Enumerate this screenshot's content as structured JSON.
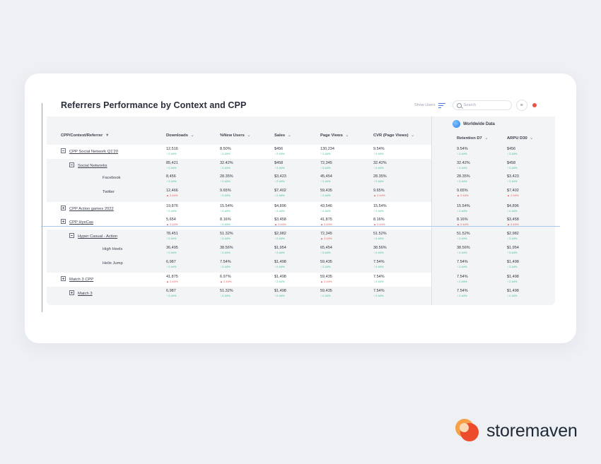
{
  "title": "Referrers Performance by Context and CPP",
  "toolbar": {
    "show_label": "Show Users",
    "search_placeholder": "Search",
    "filter_icon": "filter-lines-icon",
    "flag_icon": "flag-icon"
  },
  "worldwide_label": "Worldwide Data",
  "columns": [
    "CPP/Context/Referrer",
    "Downloads",
    "%New Users",
    "Sales",
    "Page Views",
    "CVR (Page Views)",
    "Retention D7",
    "ARPU D30"
  ],
  "rows": [
    {
      "name": "CPP Social Network Q1'20",
      "level": 0,
      "toggle": "minus",
      "link": true,
      "cells": [
        [
          "12,516",
          "2.44%",
          "up"
        ],
        [
          "8.50%",
          "2.44%",
          "up"
        ],
        [
          "$456",
          "2.44%",
          "up"
        ],
        [
          "130,234",
          "2.44%",
          "up"
        ],
        [
          "9.54%",
          "2.44%",
          "up"
        ],
        [
          "9.54%",
          "2.44%",
          "up"
        ],
        [
          "$456",
          "2.44%",
          "up"
        ]
      ]
    },
    {
      "name": "Social Networks",
      "level": 1,
      "toggle": "minus",
      "link": true,
      "cells": [
        [
          "85,421",
          "2.44%",
          "up"
        ],
        [
          "32.42%",
          "2.44%",
          "up"
        ],
        [
          "$458",
          "2.44%",
          "up"
        ],
        [
          "72,345",
          "2.44%",
          "up"
        ],
        [
          "32.42%",
          "2.44%",
          "up"
        ],
        [
          "32.42%",
          "2.44%",
          "up"
        ],
        [
          "$458",
          "2.44%",
          "up"
        ]
      ]
    },
    {
      "name": "Facebook",
      "level": 2,
      "toggle": "",
      "link": false,
      "cells": [
        [
          "8,456",
          "2.44%",
          "up"
        ],
        [
          "28.35%",
          "2.44%",
          "up"
        ],
        [
          "$3,423",
          "2.44%",
          "up"
        ],
        [
          "45,454",
          "2.44%",
          "up"
        ],
        [
          "28.35%",
          "2.44%",
          "up"
        ],
        [
          "28.35%",
          "2.44%",
          "up"
        ],
        [
          "$3,423",
          "2.44%",
          "up"
        ]
      ]
    },
    {
      "name": "Twitter",
      "level": 2,
      "toggle": "",
      "link": false,
      "cells": [
        [
          "12,466",
          "2.44%",
          "down"
        ],
        [
          "9.65%",
          "2.44%",
          "up"
        ],
        [
          "$7,402",
          "2.44%",
          "up"
        ],
        [
          "59,435",
          "2.44%",
          "up"
        ],
        [
          "9.65%",
          "2.44%",
          "down"
        ],
        [
          "9.65%",
          "2.44%",
          "down"
        ],
        [
          "$7,402",
          "2.44%",
          "down"
        ]
      ]
    },
    {
      "name": "CPP Action games 2022",
      "level": 0,
      "toggle": "plus",
      "link": true,
      "cells": [
        [
          "19,876",
          "2.44%",
          "up"
        ],
        [
          "15.54%",
          "2.44%",
          "up"
        ],
        [
          "$4,896",
          "2.44%",
          "up"
        ],
        [
          "43,546",
          "2.44%",
          "up"
        ],
        [
          "15.54%",
          "2.44%",
          "up"
        ],
        [
          "15.54%",
          "2.44%",
          "up"
        ],
        [
          "$4,896",
          "2.44%",
          "up"
        ]
      ]
    },
    {
      "name": "CPP HyeCas",
      "level": 0,
      "toggle": "plus",
      "link": true,
      "cells": [
        [
          "5,654",
          "2.44%",
          "down"
        ],
        [
          "8.16%",
          "2.44%",
          "up"
        ],
        [
          "$3,458",
          "2.44%",
          "down"
        ],
        [
          "41,875",
          "2.44%",
          "down"
        ],
        [
          "8.16%",
          "2.44%",
          "down"
        ],
        [
          "8.16%",
          "2.44%",
          "down"
        ],
        [
          "$3,458",
          "2.44%",
          "down"
        ]
      ]
    },
    {
      "name": "Hyper Casual - Action",
      "level": 1,
      "toggle": "minus",
      "link": true,
      "cells": [
        [
          "78,451",
          "2.44%",
          "up"
        ],
        [
          "51.32%",
          "2.44%",
          "up"
        ],
        [
          "$2,982",
          "2.44%",
          "up"
        ],
        [
          "72,345",
          "2.44%",
          "down"
        ],
        [
          "51.52%",
          "2.44%",
          "up"
        ],
        [
          "51.52%",
          "2.44%",
          "up"
        ],
        [
          "$2,982",
          "2.44%",
          "up"
        ]
      ]
    },
    {
      "name": "High Heels",
      "level": 2,
      "toggle": "",
      "link": false,
      "cells": [
        [
          "36,495",
          "2.44%",
          "up"
        ],
        [
          "38.56%",
          "2.44%",
          "up"
        ],
        [
          "$1,954",
          "2.44%",
          "up"
        ],
        [
          "65,454",
          "2.44%",
          "up"
        ],
        [
          "38.56%",
          "2.44%",
          "up"
        ],
        [
          "38.56%",
          "2.44%",
          "up"
        ],
        [
          "$1,954",
          "2.44%",
          "up"
        ]
      ]
    },
    {
      "name": "Helix Jump",
      "level": 2,
      "toggle": "",
      "link": false,
      "cells": [
        [
          "6,987",
          "2.44%",
          "up"
        ],
        [
          "7.54%",
          "2.44%",
          "up"
        ],
        [
          "$1,498",
          "2.44%",
          "up"
        ],
        [
          "59,435",
          "2.44%",
          "up"
        ],
        [
          "7.54%",
          "2.44%",
          "up"
        ],
        [
          "7.54%",
          "2.44%",
          "up"
        ],
        [
          "$1,498",
          "2.44%",
          "up"
        ]
      ]
    },
    {
      "name": "Match 3 CPP",
      "level": 0,
      "toggle": "plus",
      "link": true,
      "cells": [
        [
          "41,875",
          "2.44%",
          "down"
        ],
        [
          "6.97%",
          "2.44%",
          "down"
        ],
        [
          "$1,498",
          "2.44%",
          "up"
        ],
        [
          "59,435",
          "2.44%",
          "down"
        ],
        [
          "7.54%",
          "2.44%",
          "up"
        ],
        [
          "7.54%",
          "2.44%",
          "up"
        ],
        [
          "$1,498",
          "2.44%",
          "up"
        ]
      ]
    },
    {
      "name": "Match 3",
      "level": 1,
      "toggle": "plus",
      "link": true,
      "cells": [
        [
          "6,987",
          "2.44%",
          "up"
        ],
        [
          "51.32%",
          "2.44%",
          "up"
        ],
        [
          "$1,498",
          "2.44%",
          "up"
        ],
        [
          "59,435",
          "2.44%",
          "up"
        ],
        [
          "7.54%",
          "2.44%",
          "up"
        ],
        [
          "7.54%",
          "2.44%",
          "up"
        ],
        [
          "$1,498",
          "2.44%",
          "up"
        ]
      ]
    }
  ],
  "brand": {
    "name": "storemaven",
    "accent": "#ec4b2c",
    "secondary": "#f6a14a"
  }
}
